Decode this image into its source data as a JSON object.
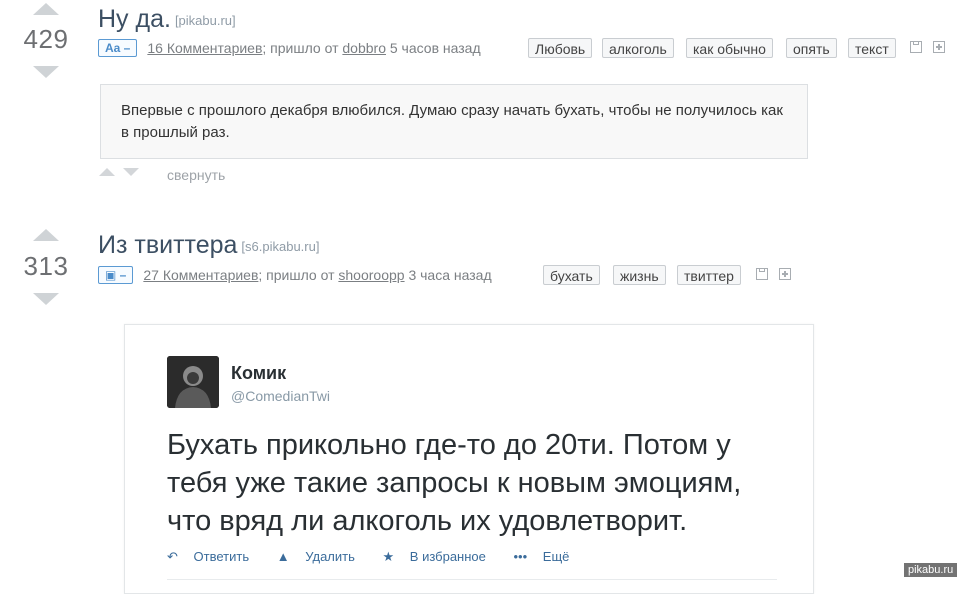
{
  "posts": [
    {
      "rating": "429",
      "title": "Ну да.",
      "source": "[pikabu.ru]",
      "type_badge": "Aa –",
      "comments": "16 Комментариев",
      "meta_mid": "; пришло от",
      "author": "dobbro",
      "time": "5 часов назад",
      "tags": [
        "Любовь",
        "алкоголь",
        "как обычно",
        "опять",
        "текст"
      ],
      "body": "Впервые с прошлого декабря влюбился. Думаю сразу начать бухать, чтобы не получилось как в прошлый раз.",
      "collapse_label": "свернуть"
    },
    {
      "rating": "313",
      "title": "Из твиттера",
      "source": "[s6.pikabu.ru]",
      "type_badge": "📷 –",
      "comments": "27 Комментариев",
      "meta_mid": "; пришло от",
      "author": "shooroopp",
      "time": "3 часа назад",
      "tags": [
        "бухать",
        "жизнь",
        "твиттер"
      ]
    }
  ],
  "tweet": {
    "name": "Комик",
    "handle": "@ComedianTwi",
    "text": "Бухать прикольно где-то до 20ти. Потом у тебя уже такие запросы к новым эмоциям, что вряд ли алкоголь их удовлетворит.",
    "actions": [
      "Ответить",
      "Удалить",
      "В избранное",
      "Ещё"
    ],
    "icons": [
      "reply-icon",
      "trash-icon",
      "star-icon",
      "more-icon"
    ]
  },
  "watermark": "pikabu.ru",
  "colors": {
    "title": "#3c4f63",
    "badge": "#4a8bc9",
    "vote_arrow": "#cfd3d6",
    "tweet_link": "#3b6c9b"
  }
}
